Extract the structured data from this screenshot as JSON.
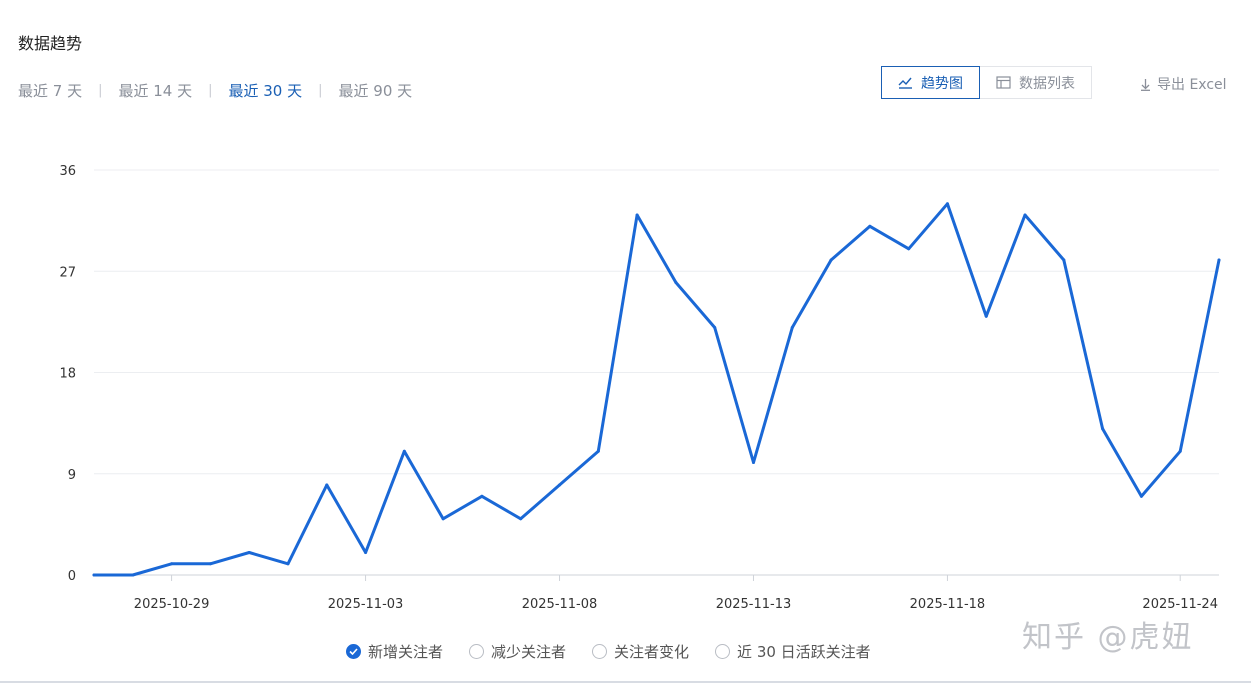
{
  "header": {
    "title": "数据趋势"
  },
  "ranges": [
    {
      "label": "最近 7 天",
      "active": false
    },
    {
      "label": "最近 14 天",
      "active": false
    },
    {
      "label": "最近 30 天",
      "active": true
    },
    {
      "label": "最近 90 天",
      "active": false
    }
  ],
  "view_toggle": {
    "trend_label": "趋势图",
    "list_label": "数据列表",
    "trend_icon": "chart-icon",
    "list_icon": "table-icon"
  },
  "export": {
    "label": "导出 Excel",
    "icon": "download-icon"
  },
  "legend": [
    {
      "label": "新增关注者",
      "checked": true
    },
    {
      "label": "减少关注者",
      "checked": false
    },
    {
      "label": "关注者变化",
      "checked": false
    },
    {
      "label": "近 30 日活跃关注者",
      "checked": false
    }
  ],
  "watermark": "知乎 @虎妞",
  "colors": {
    "accent": "#1a5fb4",
    "line": "#1a68d6",
    "grid": "#eceef1"
  },
  "chart_data": {
    "type": "line",
    "x": [
      "2025-10-27",
      "2025-10-28",
      "2025-10-29",
      "2025-10-30",
      "2025-10-31",
      "2025-11-01",
      "2025-11-02",
      "2025-11-03",
      "2025-11-04",
      "2025-11-05",
      "2025-11-06",
      "2025-11-07",
      "2025-11-08",
      "2025-11-09",
      "2025-11-10",
      "2025-11-11",
      "2025-11-12",
      "2025-11-13",
      "2025-11-14",
      "2025-11-15",
      "2025-11-16",
      "2025-11-17",
      "2025-11-18",
      "2025-11-19",
      "2025-11-20",
      "2025-11-21",
      "2025-11-22",
      "2025-11-23",
      "2025-11-24"
    ],
    "series": [
      {
        "name": "新增关注者",
        "values": [
          0,
          0,
          1,
          1,
          2,
          1,
          8,
          2,
          11,
          5,
          7,
          5,
          8,
          11,
          32,
          26,
          22,
          10,
          22,
          28,
          31,
          29,
          33,
          23,
          32,
          28,
          13,
          7,
          11,
          28
        ]
      }
    ],
    "x_ticks": [
      "2025-10-29",
      "2025-11-03",
      "2025-11-08",
      "2025-11-13",
      "2025-11-18",
      "2025-11-24"
    ],
    "y_ticks": [
      0,
      9,
      18,
      27,
      36
    ],
    "ylim": [
      0,
      36
    ],
    "grid": true,
    "legend_position": "bottom"
  }
}
